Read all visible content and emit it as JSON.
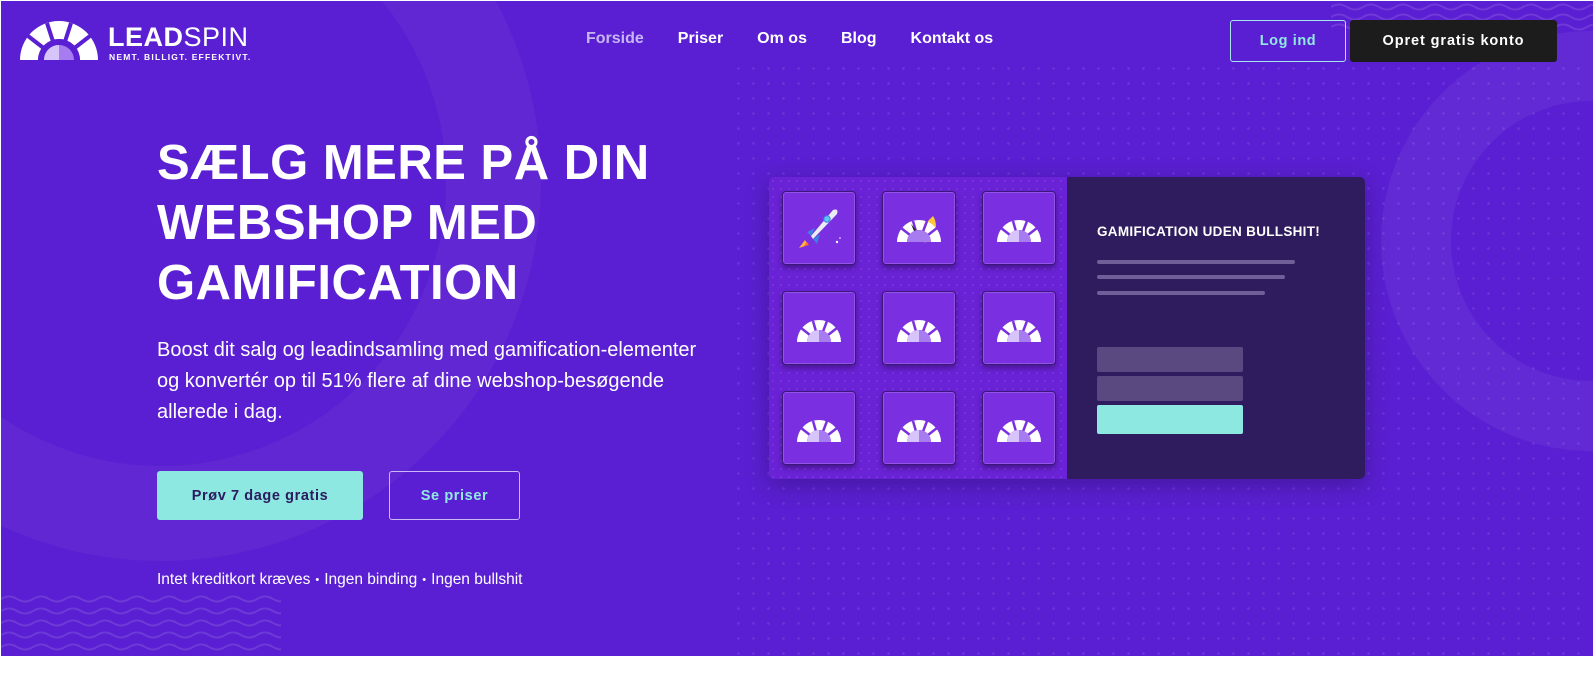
{
  "brand": {
    "name_bold": "LEAD",
    "name_light": "SPIN",
    "tagline": "NEMT. BILLIGT. EFFEKTIVT."
  },
  "nav": {
    "items": [
      {
        "label": "Forside",
        "active": true
      },
      {
        "label": "Priser",
        "active": false
      },
      {
        "label": "Om os",
        "active": false
      },
      {
        "label": "Blog",
        "active": false
      },
      {
        "label": "Kontakt os",
        "active": false
      }
    ],
    "login_label": "Log ind",
    "signup_label": "Opret gratis konto"
  },
  "hero": {
    "headline": "SÆLG MERE PÅ DIN WEBSHOP MED GAMIFICATION",
    "subtext": "Boost dit salg og leadindsamling med gamification-elementer og konvertér op til 51% flere af dine webshop-besøgende allerede i dag.",
    "cta_primary": "Prøv 7 dage gratis",
    "cta_secondary": "Se priser",
    "bullets": [
      "Intet kreditkort kræves",
      "Ingen binding",
      "Ingen bullshit"
    ]
  },
  "mockup": {
    "title": "GAMIFICATION UDEN BULLSHIT!",
    "tiles": [
      "rocket-icon",
      "wheel-icon",
      "wheel-icon",
      "wheel-icon",
      "wheel-icon",
      "wheel-icon",
      "wheel-icon",
      "wheel-icon",
      "wheel-icon"
    ]
  },
  "colors": {
    "background": "#5a1fd2",
    "accent": "#8ee8e2",
    "dark_button": "#1c1c1c",
    "panel": "#2f1c5e"
  }
}
